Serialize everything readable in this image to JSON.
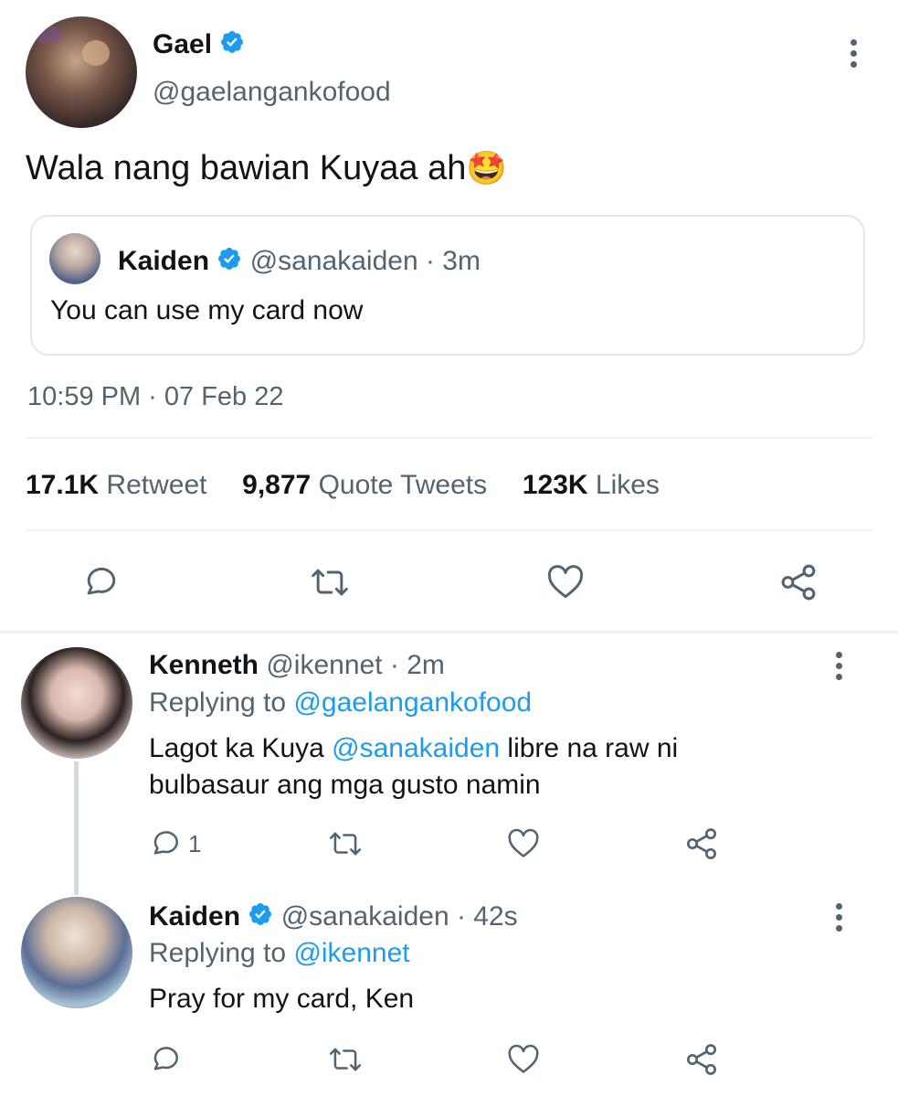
{
  "main_tweet": {
    "author_name": "Gael",
    "author_handle": "@gaelangankofood",
    "text": "Wala nang bawian Kuyaa ah",
    "emoji": "🤩",
    "quoted": {
      "author_name": "Kaiden",
      "author_handle": "@sanakaiden",
      "time": "· 3m",
      "text": "You can use my card now"
    },
    "timestamp": "10:59 PM · 07 Feb 22",
    "stats": {
      "retweets_count": "17.1K",
      "retweets_label": "Retweet",
      "quotes_count": "9,877",
      "quotes_label": "Quote Tweets",
      "likes_count": "123K",
      "likes_label": "Likes"
    }
  },
  "replies": [
    {
      "author_name": "Kenneth",
      "author_handle": "@ikennet",
      "time": "· 2m",
      "replying_prefix": "Replying to",
      "replying_handle": "@gaelangankofood",
      "text_line1_a": "Lagot ka Kuya",
      "text_line1_mention": "@sanakaiden",
      "text_line1_b": "libre na raw ni",
      "text_line2": "bulbasaur ang mga gusto namin",
      "reply_count": "1"
    },
    {
      "author_name": "Kaiden",
      "author_handle": "@sanakaiden",
      "time": "· 42s",
      "replying_prefix": "Replying to",
      "replying_handle": "@ikennet",
      "text": "Pray for my card, Ken"
    }
  ],
  "colors": {
    "accent": "#1d9bf0",
    "muted": "#536471",
    "text": "#0f1419",
    "divider": "#eff3f4"
  },
  "icons": [
    "verified-badge-icon",
    "more-options-icon",
    "reply-icon",
    "retweet-icon",
    "like-icon",
    "share-icon"
  ]
}
